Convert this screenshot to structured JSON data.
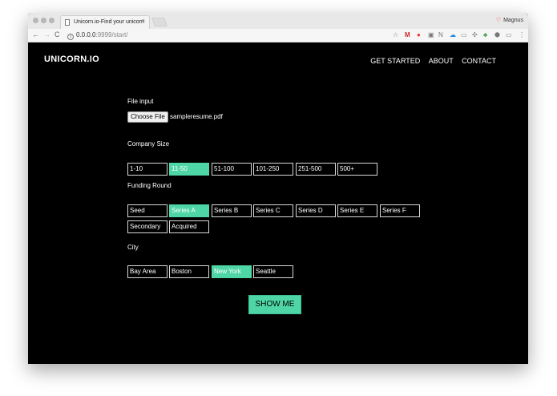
{
  "browser": {
    "tab_title": "Unicorn.io-Find your unicorn",
    "tab_close": "×",
    "profile_name": "Magnus",
    "url_host": "0.0.0.0",
    "url_path": ":9999/start/",
    "nav_back": "←",
    "nav_forward": "→",
    "nav_reload": "C"
  },
  "site": {
    "logo": "UNICORN.IO",
    "nav": [
      "GET STARTED",
      "ABOUT",
      "CONTACT"
    ],
    "file_label": "File input",
    "choose_file": "Choose File",
    "file_name": "sampleresume.pdf",
    "company_size_label": "Company Size",
    "company_size": [
      {
        "label": "1-10",
        "selected": false
      },
      {
        "label": "11-50",
        "selected": true
      },
      {
        "label": "51-100",
        "selected": false
      },
      {
        "label": "101-250",
        "selected": false
      },
      {
        "label": "251-500",
        "selected": false
      },
      {
        "label": "500+",
        "selected": false
      }
    ],
    "funding_label": "Funding Round",
    "funding": [
      {
        "label": "Seed",
        "selected": false
      },
      {
        "label": "Series A",
        "selected": true
      },
      {
        "label": "Series B",
        "selected": false
      },
      {
        "label": "Series C",
        "selected": false
      },
      {
        "label": "Series D",
        "selected": false
      },
      {
        "label": "Series E",
        "selected": false
      },
      {
        "label": "Series F",
        "selected": false
      },
      {
        "label": "Secondary",
        "selected": false
      },
      {
        "label": "Acquired",
        "selected": false
      }
    ],
    "city_label": "City",
    "city": [
      {
        "label": "Bay Area",
        "selected": false
      },
      {
        "label": "Boston",
        "selected": false
      },
      {
        "label": "New York",
        "selected": true
      },
      {
        "label": "Seattle",
        "selected": false
      }
    ],
    "submit": "SHOW ME"
  },
  "colors": {
    "accent": "#4fd6a6",
    "background": "#000000"
  }
}
